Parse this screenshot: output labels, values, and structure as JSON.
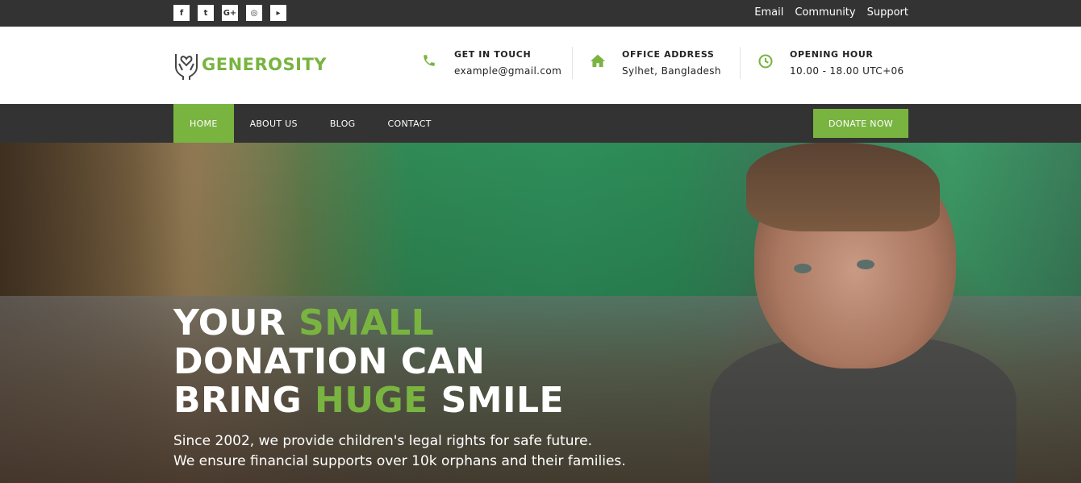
{
  "social": [
    {
      "name": "facebook-icon",
      "glyph": "f"
    },
    {
      "name": "twitter-icon",
      "glyph": "t"
    },
    {
      "name": "google-plus-icon",
      "glyph": "G+"
    },
    {
      "name": "instagram-icon",
      "glyph": "◎"
    },
    {
      "name": "youtube-icon",
      "glyph": "▸"
    }
  ],
  "top_links": [
    "Email",
    "Community",
    "Support"
  ],
  "logo": {
    "text": "GENEROSITY"
  },
  "contact": {
    "touch": {
      "title": "GET IN TOUCH",
      "value": "example@gmail.com",
      "icon": "phone-icon"
    },
    "office": {
      "title": "OFFICE ADDRESS",
      "value": "Sylhet, Bangladesh",
      "icon": "home-icon"
    },
    "hours": {
      "title": "OPENING HOUR",
      "value": "10.00 - 18.00 UTC+06",
      "icon": "clock-icon"
    }
  },
  "nav": {
    "items": [
      "HOME",
      "ABOUT US",
      "BLOG",
      "CONTACT"
    ],
    "active": "HOME",
    "donate_label": "DONATE NOW"
  },
  "hero": {
    "line1_a": "YOUR ",
    "line1_b": "SMALL",
    "line2": "DONATION CAN",
    "line3_a": "BRING ",
    "line3_b": "HUGE",
    "line3_c": " SMILE",
    "sub1": "Since 2002, we provide children's legal rights for safe future.",
    "sub2": "We ensure financial supports over 10k orphans and their families."
  },
  "colors": {
    "accent": "#79b441",
    "dark": "#333333"
  }
}
